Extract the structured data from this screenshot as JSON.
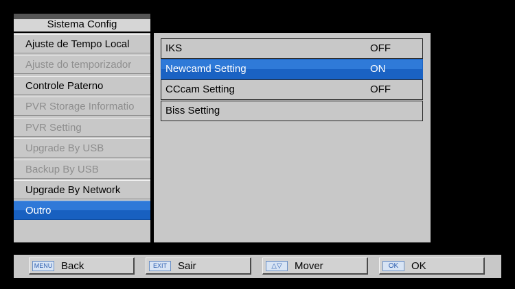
{
  "title": "Sistema Config",
  "sidebar": {
    "items": [
      {
        "label": "Ajuste de Tempo Local",
        "state": "enabled"
      },
      {
        "label": "Ajuste do temporizador",
        "state": "disabled"
      },
      {
        "label": "Controle Paterno",
        "state": "enabled"
      },
      {
        "label": "PVR Storage Informatio",
        "state": "disabled"
      },
      {
        "label": "PVR Setting",
        "state": "disabled"
      },
      {
        "label": "Upgrade By USB",
        "state": "disabled"
      },
      {
        "label": "Backup By USB",
        "state": "disabled"
      },
      {
        "label": "Upgrade By Network",
        "state": "enabled"
      },
      {
        "label": "Outro",
        "state": "selected"
      }
    ]
  },
  "settings": [
    {
      "label": "IKS",
      "value": "OFF"
    },
    {
      "label": "Newcamd Setting",
      "value": "ON",
      "selected": true
    },
    {
      "label": "CCcam Setting",
      "value": "OFF"
    },
    {
      "label": "Biss Setting",
      "value": ""
    }
  ],
  "footer": [
    {
      "key": "MENU",
      "label": "Back"
    },
    {
      "key": "EXIT",
      "label": "Sair"
    },
    {
      "key": "△▽",
      "label": "Mover"
    },
    {
      "key": "OK",
      "label": "OK"
    }
  ],
  "colors": {
    "background": "#000000",
    "panel": "#c8c8c8",
    "highlight": "#2f79d8",
    "disabled_text": "#8e8e8e"
  }
}
